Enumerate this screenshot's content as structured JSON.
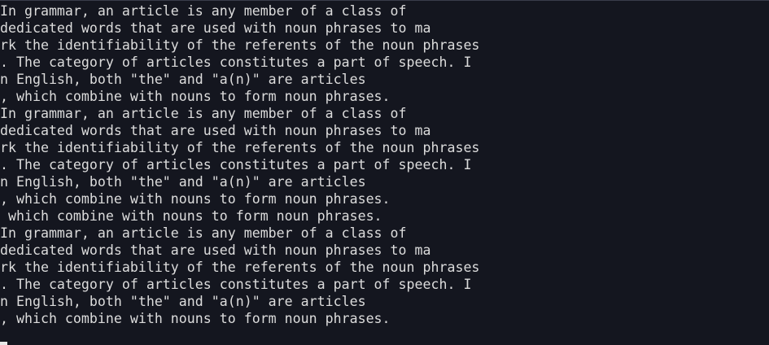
{
  "terminal": {
    "lines": [
      "In grammar, an article is any member of a class of",
      "dedicated words that are used with noun phrases to ma",
      "rk the identifiability of the referents of the noun phrases",
      ". The category of articles constitutes a part of speech. I",
      "n English, both \"the\" and \"a(n)\" are articles",
      ", which combine with nouns to form noun phrases.",
      "In grammar, an article is any member of a class of",
      "dedicated words that are used with noun phrases to ma",
      "rk the identifiability of the referents of the noun phrases",
      ". The category of articles constitutes a part of speech. I",
      "n English, both \"the\" and \"a(n)\" are articles",
      ", which combine with nouns to form noun phrases.",
      " which combine with nouns to form noun phrases.",
      "In grammar, an article is any member of a class of",
      "dedicated words that are used with noun phrases to ma",
      "rk the identifiability of the referents of the noun phrases",
      ". The category of articles constitutes a part of speech. I",
      "n English, both \"the\" and \"a(n)\" are articles",
      ", which combine with nouns to form noun phrases."
    ]
  }
}
